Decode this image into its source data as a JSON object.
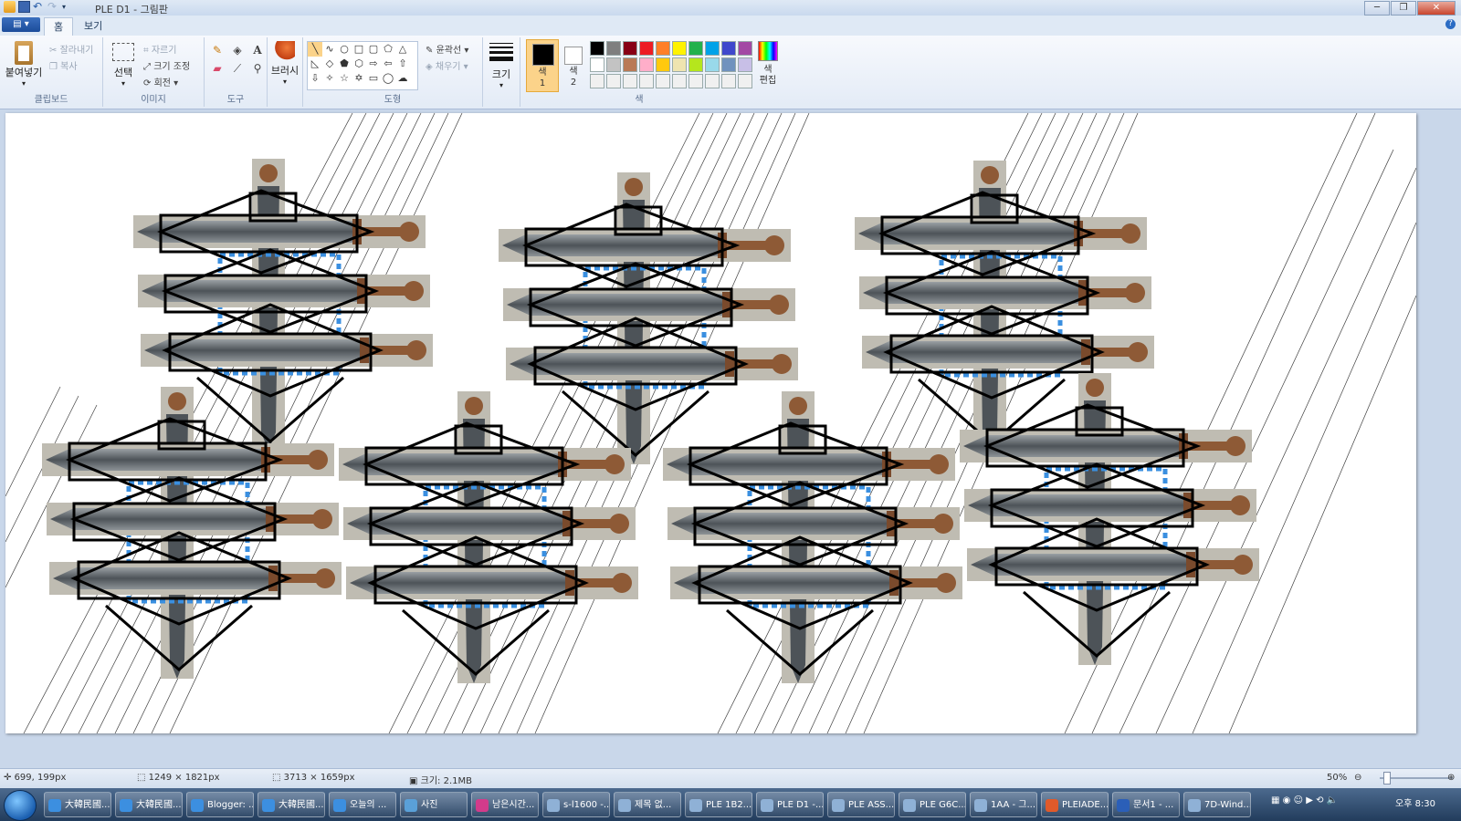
{
  "window": {
    "title": "PLE D1 - 그림판",
    "buttons": {
      "minimize": "─",
      "maximize": "❐",
      "close": "✕"
    }
  },
  "ribbon_tabs": {
    "file": "▤ ▾",
    "home": "홈",
    "view": "보기",
    "help": "?"
  },
  "clipboard": {
    "paste": "붙여넣기",
    "cut": "잘라내기",
    "copy": "복사",
    "group": "클립보드"
  },
  "image": {
    "select": "선택",
    "crop": "자르기",
    "resize": "크기 조정",
    "rotate": "회전",
    "group": "이미지"
  },
  "tools": {
    "group": "도구",
    "brushes": "브러시"
  },
  "shapes": {
    "group": "도형",
    "outline": "윤곽선",
    "fill": "채우기"
  },
  "size": {
    "label": "크기"
  },
  "colors": {
    "color1": "색\n1",
    "color2": "색\n2",
    "group": "색",
    "edit": "색\n편집",
    "color1_value": "#000000",
    "color2_value": "#ffffff",
    "palette": [
      "#000000",
      "#7f7f7f",
      "#880015",
      "#ed1c24",
      "#ff7f27",
      "#fff200",
      "#22b14c",
      "#00a2e8",
      "#3f48cc",
      "#a349a4",
      "#ffffff",
      "#c3c3c3",
      "#b97a57",
      "#ffaec9",
      "#ffc90e",
      "#efe4b0",
      "#b5e61d",
      "#99d9ea",
      "#7092be",
      "#c8bfe7",
      "#f0f0f0",
      "#f0f0f0",
      "#f0f0f0",
      "#f0f0f0",
      "#f0f0f0",
      "#f0f0f0",
      "#f0f0f0",
      "#f0f0f0",
      "#f0f0f0",
      "#f0f0f0"
    ]
  },
  "status": {
    "cursor_pos": "699, 199px",
    "selection_size": "1249 × 1821px",
    "image_size": "3713 × 1659px",
    "file_size": "크기: 2.1MB",
    "zoom": "50%"
  },
  "taskbar": {
    "items": [
      "大韓民國...",
      "大韓民國...",
      "Blogger: ...",
      "大韓民國...",
      "오늘의 ...",
      "사진",
      "남은시간...",
      "s-l1600 -...",
      "제목 없...",
      "PLE 1B2...",
      "PLE D1 -...",
      "PLE ASS...",
      "PLE G6C...",
      "1AA - 그...",
      "PLEIADE...",
      "문서1 - ...",
      "7D-Wind..."
    ],
    "icon_colors": [
      "#3c8fe0",
      "#3c8fe0",
      "#3c8fe0",
      "#3c8fe0",
      "#3c8fe0",
      "#5aa0d8",
      "#d23b8b",
      "#8fb1d6",
      "#8fb1d6",
      "#8fb1d6",
      "#8fb1d6",
      "#8fb1d6",
      "#8fb1d6",
      "#8fb1d6",
      "#e05a2b",
      "#2b5fb8",
      "#8fb1d6"
    ],
    "clock": "오후 8:30"
  }
}
